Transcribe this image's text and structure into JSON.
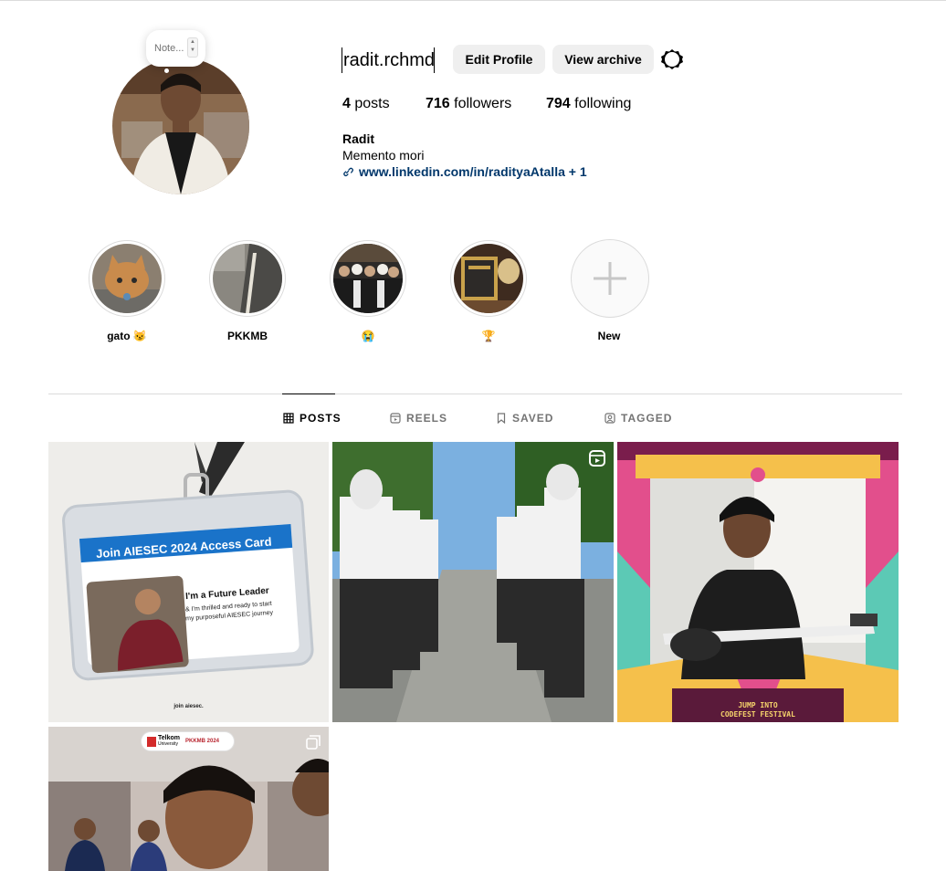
{
  "note": {
    "placeholder": "Note..."
  },
  "profile": {
    "username": "radit.rchmd",
    "edit_label": "Edit Profile",
    "archive_label": "View archive",
    "posts_count": "4",
    "posts_label": " posts",
    "followers_count": "716",
    "followers_label": " followers",
    "following_count": "794",
    "following_label": " following",
    "name": "Radit",
    "bio": "Memento mori",
    "link": "www.linkedin.com/in/radityaAtalla + 1"
  },
  "highlights": [
    {
      "label": "gato 😼"
    },
    {
      "label": "PKKMB"
    },
    {
      "label": "😭"
    },
    {
      "label": "🏆"
    },
    {
      "label": "New"
    }
  ],
  "tabs": [
    {
      "label": "POSTS",
      "icon": "grid-icon",
      "active": true
    },
    {
      "label": "REELS",
      "icon": "reels-icon"
    },
    {
      "label": "SAVED",
      "icon": "bookmark-icon"
    },
    {
      "label": "TAGGED",
      "icon": "tag-icon"
    }
  ],
  "posts": {
    "p1": {
      "title": "Join AIESEC 2024 Access Card",
      "headline": "I'm a Future Leader",
      "line1": "& I'm thrilled and ready to start",
      "line2": "my purposeful AIESEC journey",
      "footer": "join aiesec."
    },
    "p3": {
      "line1": "JUMP INTO",
      "line2": "CODEFEST FESTIVAL"
    },
    "p4": {
      "brand1": "Telkom",
      "brand1_sub": "University",
      "brand2": "PKKMB 2024"
    }
  },
  "colors": {
    "link": "#00376b",
    "button_bg": "#efefef",
    "muted": "#737373",
    "divider": "#dbdbdb"
  }
}
